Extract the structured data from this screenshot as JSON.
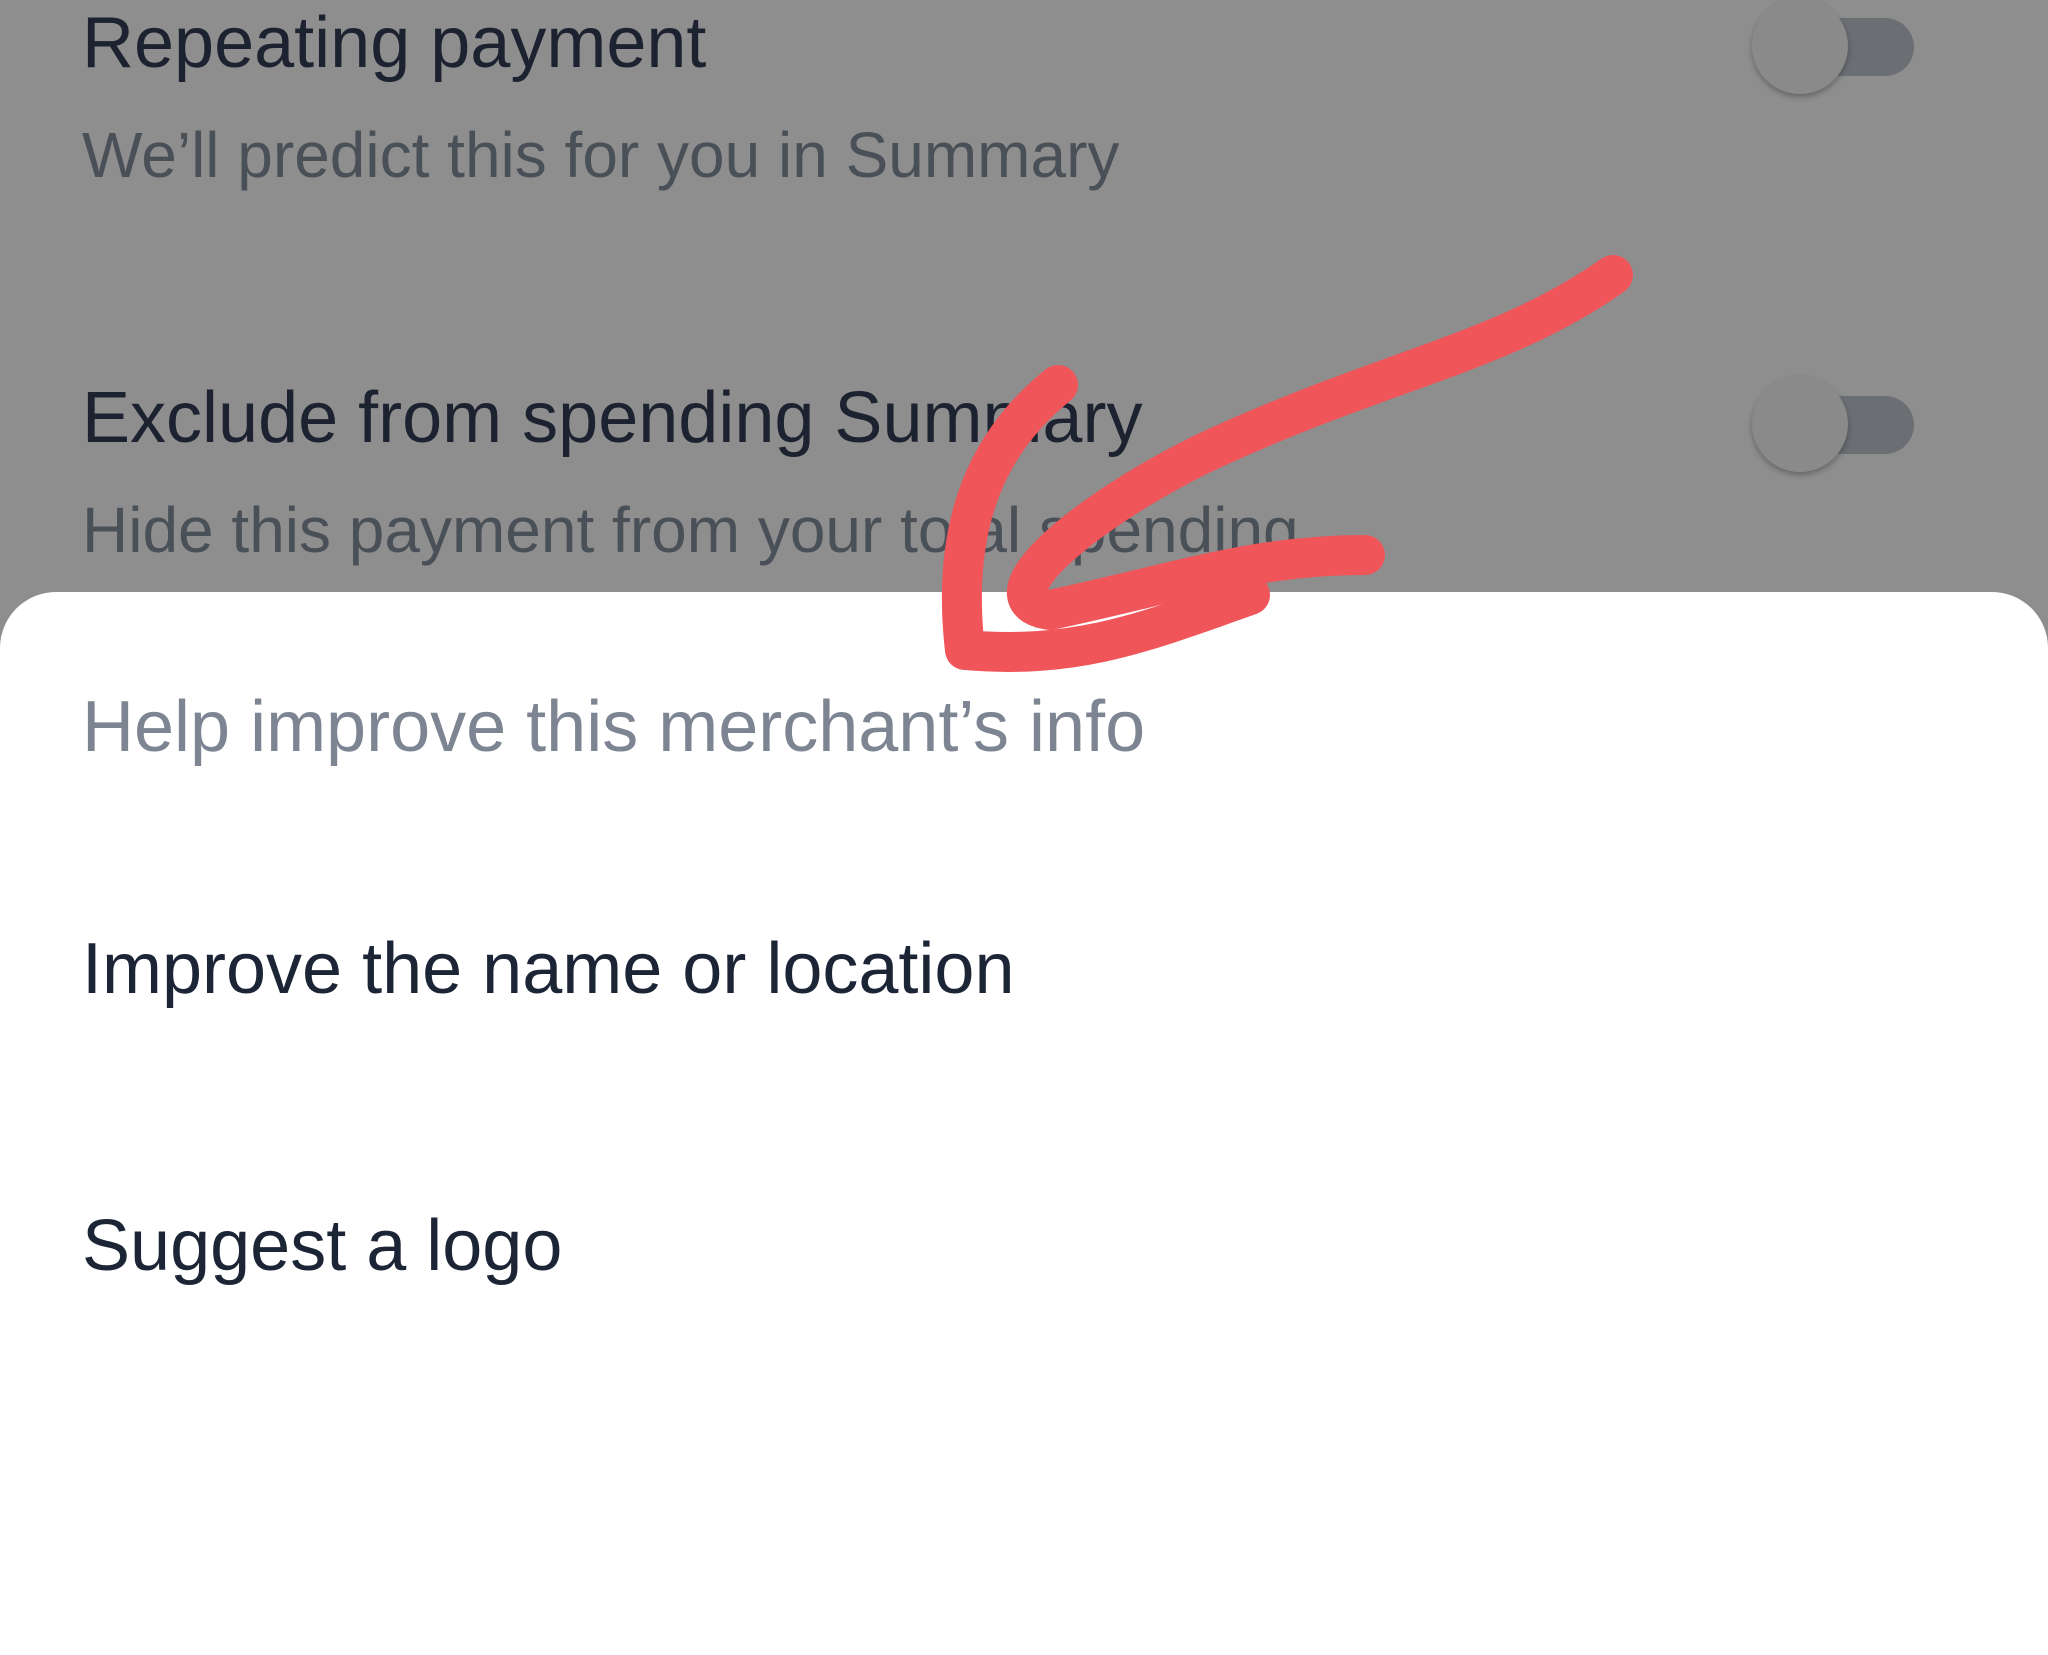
{
  "background_settings": {
    "rows": [
      {
        "title": "Repeating payment",
        "subtitle": "We’ll predict this for you in Summary",
        "toggle_on": false
      },
      {
        "title": "Exclude from spending Summary",
        "subtitle": "Hide this payment from your total spending",
        "toggle_on": false
      }
    ]
  },
  "sheet": {
    "header": "Help improve this merchant’s info",
    "options": [
      {
        "label": "Improve the name or location"
      },
      {
        "label": "Suggest a logo"
      }
    ]
  },
  "colors": {
    "annotation": "#f0555a",
    "primary_text": "#1c2536",
    "secondary_text": "#7d8593",
    "scrim": "#8e8e8e"
  },
  "icons": {
    "annotation": "red-arrow-icon"
  }
}
